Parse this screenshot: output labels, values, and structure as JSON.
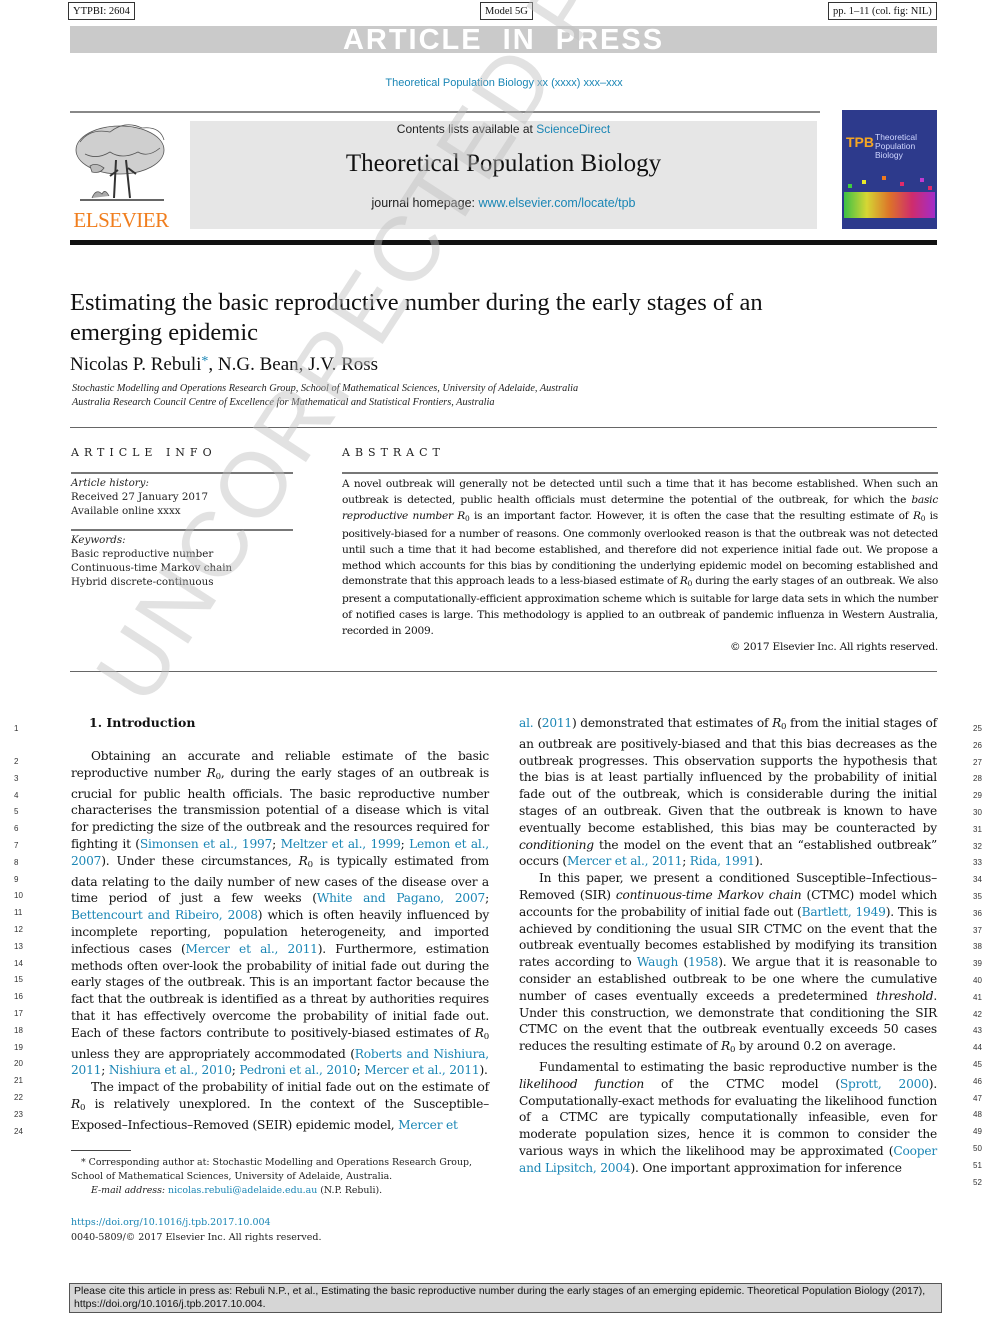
{
  "header_labels": {
    "id": "YTPBI: 2604",
    "model": "Model 5G",
    "pages": "pp. 1–11 (col. fig: NIL)"
  },
  "banner": "ARTICLE IN PRESS",
  "journal_ref": "Theoretical Population Biology xx (xxxx) xxx–xxx",
  "masthead": {
    "contents_prefix": "Contents lists available at ",
    "contents_link": "ScienceDirect",
    "journal_title": "Theoretical Population Biology",
    "homepage_prefix": "journal homepage: ",
    "homepage_link": "www.elsevier.com/locate/tpb",
    "publisher_logo": "ELSEVIER",
    "cover_abbrev": "TPB",
    "cover_title_lines": [
      "Theoretical",
      "Population",
      "Biology"
    ]
  },
  "article": {
    "title": "Estimating the basic reproductive number during the early stages of an emerging epidemic",
    "authors_first": "Nicolas P. Rebuli",
    "authors_star": "*",
    "authors_rest": ", N.G. Bean, J.V. Ross",
    "affiliations": [
      "Stochastic Modelling and Operations Research Group, School of Mathematical Sciences, University of Adelaide, Australia",
      "Australia Research Council Centre of Excellence for Mathematical and Statistical Frontiers, Australia"
    ]
  },
  "article_info": {
    "heading": "ARTICLE INFO",
    "history_label": "Article history:",
    "received": "Received 27 January 2017",
    "available": "Available online xxxx",
    "keywords_label": "Keywords:",
    "keywords": [
      "Basic reproductive number",
      "Continuous-time Markov chain",
      "Hybrid discrete-continuous"
    ]
  },
  "abstract": {
    "heading": "ABSTRACT",
    "p1": "A novel outbreak will generally not be detected until such a time that it has become established. When such an outbreak is detected, public health officials must determine the potential of the outbreak, for which the ",
    "p1_italic": "basic reproductive number R",
    "p2": " is an important factor. However, it is often the case that the resulting estimate of ",
    "p3": " is positively-biased for a number of reasons. One commonly overlooked reason is that the outbreak was not detected until such a time that it had become established, and therefore did not experience initial fade out. We propose a method which accounts for this bias by conditioning the underlying epidemic model on becoming established and demonstrate that this approach leads to a less-biased estimate of ",
    "p4": " during the early stages of an outbreak. We also present a computationally-efficient approximation scheme which is suitable for large data sets in which the number of notified cases is large. This methodology is applied to an outbreak of pandemic influenza in Western Australia, recorded in 2009.",
    "copyright": "© 2017 Elsevier Inc. All rights reserved."
  },
  "intro": {
    "heading": "1.  Introduction",
    "left_col": {
      "a": "Obtaining an accurate and reliable estimate of the basic reproductive number ",
      "b": ", during the early stages of an outbreak is crucial for public health officials. The basic reproductive number characterises the transmission potential of a disease which is vital for predicting the size of the outbreak and the resources required for fighting it  (",
      "c1": "Simonsen et al., 1997",
      "c2": "Meltzer et al., 1999",
      "c3": "Lemon et al., 2007",
      "d": "). Under these circumstances, ",
      "e": " is typically estimated from data relating to the daily number of new cases of the disease over a time period of just a few weeks  (",
      "c4": "White and Pagano, 2007",
      "c5": "Bettencourt and Ribeiro, 2008",
      "f": ") which is often heavily influenced by incomplete reporting, population heterogeneity, and imported infectious cases  (",
      "c6": "Mercer et al., 2011",
      "g": "). Furthermore, estimation methods often over-look the probability of initial fade out during the early stages of the outbreak. This is an important factor because the fact that the outbreak is identified as a threat by authorities requires that it has effectively overcome the probability of initial fade out. Each of these factors contribute to positively-biased estimates of ",
      "h": " unless they are appropriately accommodated  (",
      "c7": "Roberts and Nishiura, 2011",
      "c8": "Nishiura et al., 2010",
      "c9": "Pedroni et al., 2010",
      "c10": "Mercer et al., 2011",
      "i": ").",
      "p2a": "The impact of the probability of initial fade out on the estimate of ",
      "p2b": " is relatively unexplored. In the context of the Susceptible–Exposed–Infectious–Removed (SEIR) epidemic model,  ",
      "c11": "Mercer et"
    },
    "right_col": {
      "c12": "al.",
      "c13": "2011",
      "a": " demonstrated that estimates of ",
      "b": " from the initial stages of an outbreak are positively-biased and that this bias decreases as the outbreak progresses. This observation supports the hypothesis that the bias is at least partially influenced by the probability of initial fade out of the outbreak, which is considerable during the initial stages of an outbreak. Given that the outbreak is known to have eventually become established, this bias may be counteracted by ",
      "b_italic": "conditioning",
      "c": " the model on the event that an “established outbreak” occurs  (",
      "c14": "Mercer et al., 2011",
      "c15": "Rida, 1991",
      "d": ").",
      "p2a": "In this paper, we present a conditioned Susceptible–Infectious–Removed (SIR) ",
      "p2_italic": "continuous-time Markov chain",
      "p2b": " (CTMC) model which accounts for the probability of initial fade out  (",
      "c16": "Bartlett, 1949",
      "p2c": "). This is achieved by conditioning the usual SIR CTMC on the event that the outbreak eventually becomes established by modifying its transition rates according to  ",
      "c17": "Waugh",
      "c18": "1958",
      "p2d": "). We argue that it is reasonable to consider an established outbreak to be one where the cumulative number of cases eventually exceeds a predetermined ",
      "p2_italic2": "threshold",
      "p2e": ". Under this construction, we demonstrate that conditioning the SIR CTMC on the event that the outbreak eventually exceeds 50 cases reduces the resulting estimate of ",
      "p2f": " by around 0.2 on average.",
      "p3a": "Fundamental to estimating the basic reproductive number is the ",
      "p3_italic": "likelihood function",
      "p3b": " of the CTMC model  (",
      "c19": "Sprott, 2000",
      "p3c": "). Computationally-exact methods for evaluating the likelihood function of a CTMC are typically computationally infeasible, even for moderate population sizes, hence it is common to consider the various ways in which the likelihood may be approximated  (",
      "c20": "Cooper and Lipsitch, 2004",
      "p3d": "). One important approximation for inference"
    }
  },
  "r0": "R",
  "r0_sub": "0",
  "line_numbers_left": [
    1,
    2,
    3,
    4,
    5,
    6,
    7,
    8,
    9,
    10,
    11,
    12,
    13,
    14,
    15,
    16,
    17,
    18,
    19,
    20,
    21,
    22,
    23,
    24
  ],
  "line_numbers_right": [
    25,
    26,
    27,
    28,
    29,
    30,
    31,
    32,
    33,
    34,
    35,
    36,
    37,
    38,
    39,
    40,
    41,
    42,
    43,
    44,
    45,
    46,
    47,
    48,
    49,
    50,
    51,
    52
  ],
  "footnote": {
    "star": "*",
    "text": " Corresponding author at: Stochastic Modelling and Operations Research Group, School of Mathematical Sciences, University of Adelaide, Australia.",
    "email_label": "E-mail address:",
    "email": "nicolas.rebuli@adelaide.edu.au",
    "email_suffix": " (N.P. Rebuli)."
  },
  "doi": {
    "link": "https://doi.org/10.1016/j.tpb.2017.10.004",
    "issn": "0040-5809/© 2017 Elsevier Inc. All rights reserved."
  },
  "cite_box": "Please cite this article in press as: Rebuli N.P., et al., Estimating the basic reproductive number during the early stages of an emerging epidemic. Theoretical Population Biology (2017), https://doi.org/10.1016/j.tpb.2017.10.004.",
  "watermark": "UNCORRECTED PROOF",
  "colors": {
    "link": "#1a86b5",
    "elsevier_orange": "#f07e1e",
    "banner_gray": "#cacaca",
    "masthead_gray": "#e6e6e6"
  }
}
